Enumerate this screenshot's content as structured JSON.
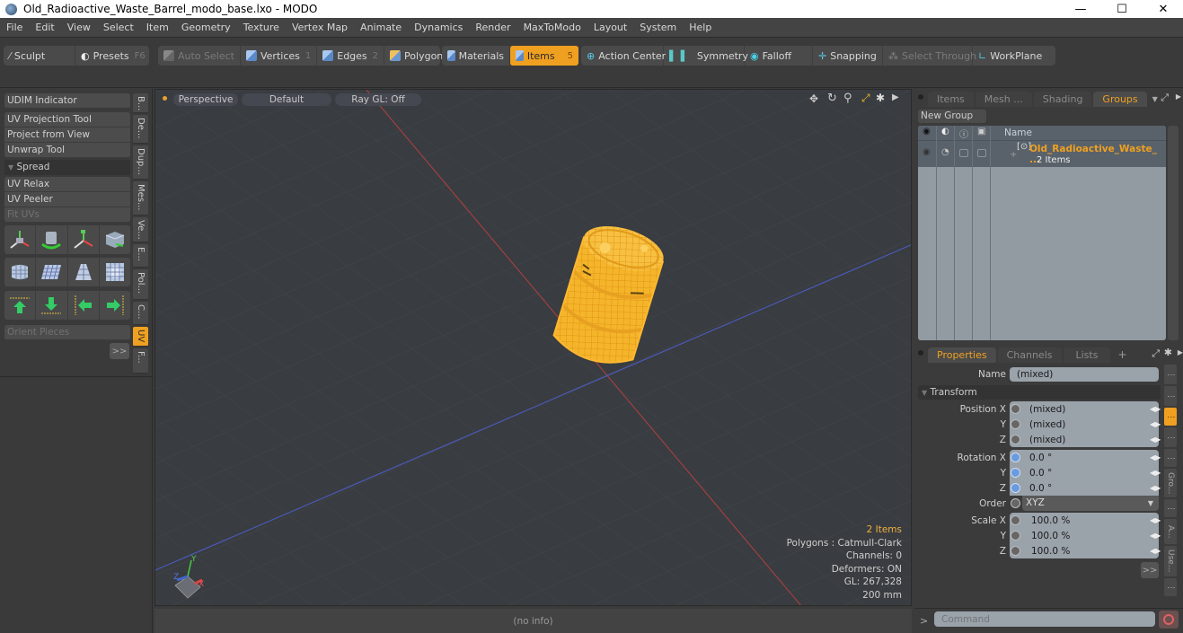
{
  "window": {
    "title": "Old_Radioactive_Waste_Barrel_modo_base.lxo - MODO",
    "minimize": "—",
    "maximize": "☐",
    "close": "✕"
  },
  "menu": [
    "File",
    "Edit",
    "View",
    "Select",
    "Item",
    "Geometry",
    "Texture",
    "Vertex Map",
    "Animate",
    "Dynamics",
    "Render",
    "MaxToModo",
    "Layout",
    "System",
    "Help"
  ],
  "toolbar": {
    "sculpt": "Sculpt",
    "presets": "Presets",
    "presets_key": "F6",
    "auto_select": "Auto Select",
    "vertices": "Vertices",
    "vertices_key": "1",
    "edges": "Edges",
    "edges_key": "2",
    "polygons": "Polygons",
    "materials": "Materials",
    "items": "Items",
    "items_key": "5",
    "action_center": "Action Center",
    "symmetry": "Symmetry",
    "falloff": "Falloff",
    "snapping": "Snapping",
    "select_through": "Select Through",
    "workplane": "WorkPlane"
  },
  "left_panel": {
    "udim": "UDIM Indicator",
    "uv_projection": "UV Projection Tool",
    "project_from_view": "Project from View",
    "unwrap": "Unwrap Tool",
    "spread": "Spread",
    "uv_relax": "UV Relax",
    "uv_peeler": "UV Peeler",
    "fit_uvs": "Fit UVs",
    "orient_pieces": "Orient Pieces",
    "more": ">>",
    "vtabs": [
      "B...",
      "De...",
      "Dup...",
      "Mes...",
      "Ve...",
      "E...",
      "Pol...",
      "C...",
      "UV",
      "F..."
    ],
    "active_vtab": "UV"
  },
  "viewport": {
    "view": "Perspective",
    "shading": "Default",
    "raygl": "Ray GL: Off",
    "info": {
      "items": "2 Items",
      "polygons": "Polygons : Catmull-Clark",
      "channels": "Channels: 0",
      "deformers": "Deformers: ON",
      "gl": "GL: 267,328",
      "unit": "200 mm"
    },
    "status": "(no info)",
    "axis_y": "Y",
    "axis_x": "X",
    "axis_z": "Z"
  },
  "groups_panel": {
    "tabs": [
      "Items",
      "Mesh ...",
      "Shading",
      "Groups"
    ],
    "active_tab": "Groups",
    "new_group": "New Group",
    "name_col": "Name",
    "group_name": "Old_Radioactive_Waste_ ...",
    "group_count": "2 Items"
  },
  "properties_panel": {
    "tabs": [
      "Properties",
      "Channels",
      "Lists"
    ],
    "active_tab": "Properties",
    "add_tab": "+",
    "name_label": "Name",
    "name_value": "(mixed)",
    "transform": "Transform",
    "position": {
      "label_x": "Position X",
      "label_y": "Y",
      "label_z": "Z",
      "x": "(mixed)",
      "y": "(mixed)",
      "z": "(mixed)"
    },
    "rotation": {
      "label_x": "Rotation X",
      "label_y": "Y",
      "label_z": "Z",
      "x": "0.0 °",
      "y": "0.0 °",
      "z": "0.0 °"
    },
    "order": {
      "label": "Order",
      "value": "XYZ"
    },
    "scale": {
      "label_x": "Scale X",
      "label_y": "Y",
      "label_z": "Z",
      "x": "100.0 %",
      "y": "100.0 %",
      "z": "100.0 %"
    },
    "more": ">>",
    "side_tabs": [
      "Gro...",
      "A...",
      "Use..."
    ]
  },
  "command": {
    "prompt": ">",
    "placeholder": "Command"
  },
  "colors": {
    "accent": "#f0a020",
    "viewport_bg": "#393c40",
    "panel_bg": "#3b3b3b"
  }
}
